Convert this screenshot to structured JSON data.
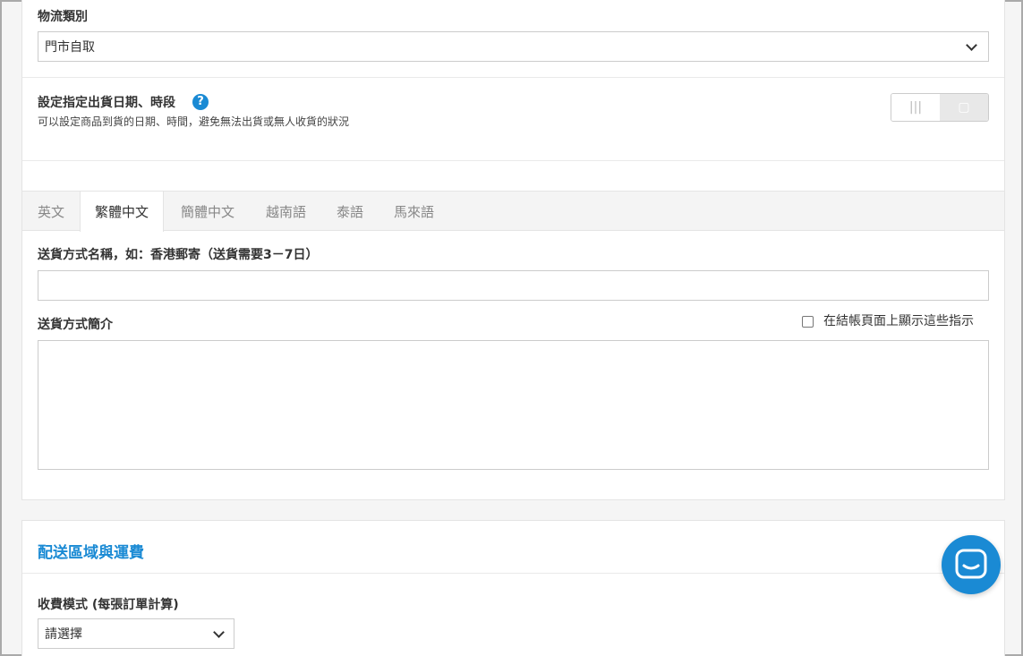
{
  "logistics": {
    "label": "物流類別",
    "selected": "門市自取"
  },
  "schedule": {
    "title": "設定指定出貨日期、時段",
    "help_glyph": "?",
    "description": "可以設定商品到貨的日期、時間，避免無法出貨或無人收貨的狀況",
    "toggle_off_glyph": "|||",
    "toggle_on_glyph": "▢"
  },
  "tabs": [
    {
      "label": "英文"
    },
    {
      "label": "繁體中文"
    },
    {
      "label": "簡體中文"
    },
    {
      "label": "越南語"
    },
    {
      "label": "泰語"
    },
    {
      "label": "馬來語"
    }
  ],
  "shipping_name": {
    "label": "送貨方式名稱，如：香港郵寄（送貨需要3－7日）",
    "value": ""
  },
  "shipping_desc": {
    "label": "送貨方式簡介",
    "checkbox_label": "在結帳頁面上顯示這些指示",
    "value": ""
  },
  "zones": {
    "title": "配送區域與運費",
    "fee_mode_label": "收費模式 (每張訂單計算)",
    "fee_mode_selected": "請選擇"
  },
  "colors": {
    "accent": "#1a8ad4"
  }
}
